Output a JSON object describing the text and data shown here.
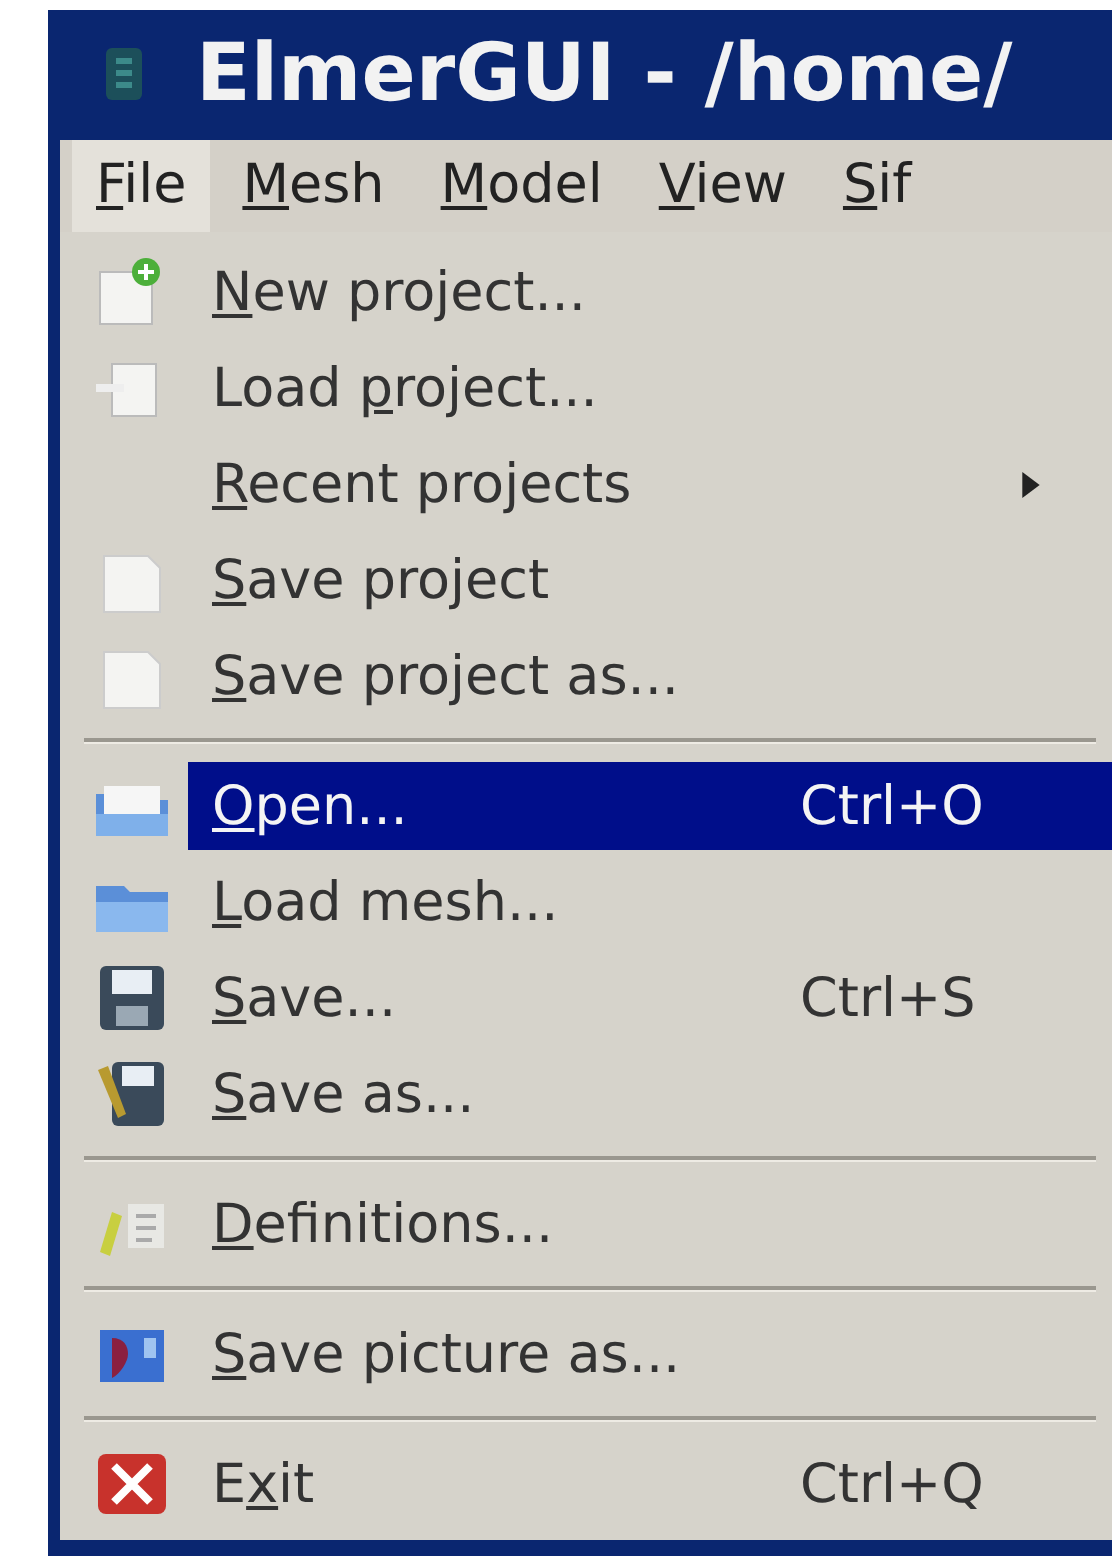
{
  "window": {
    "title": "ElmerGUI - /home/"
  },
  "menubar": [
    {
      "access_key": "F",
      "after": "ile",
      "selected": true
    },
    {
      "access_key": "M",
      "after": "esh",
      "selected": false
    },
    {
      "access_key": "M",
      "after": "odel",
      "selected": false
    },
    {
      "access_key": "V",
      "after": "iew",
      "selected": false
    },
    {
      "access_key": "S",
      "after": "if",
      "selected": false
    }
  ],
  "menu": [
    {
      "kind": "item",
      "access_key": "N",
      "after": "ew project...",
      "selected": false
    },
    {
      "kind": "item",
      "before": "Load ",
      "access_key": "p",
      "after": "roject...",
      "selected": false
    },
    {
      "kind": "item",
      "access_key": "R",
      "after": "ecent projects",
      "has_submenu": true,
      "selected": false
    },
    {
      "kind": "item",
      "access_key": "S",
      "after": "ave project",
      "selected": false
    },
    {
      "kind": "item",
      "access_key": "S",
      "after": "ave project as...",
      "selected": false
    },
    {
      "kind": "separator"
    },
    {
      "kind": "item",
      "access_key": "O",
      "after": "pen...",
      "shortcut": "Ctrl+O",
      "selected": true
    },
    {
      "kind": "item",
      "access_key": "L",
      "after": "oad mesh...",
      "selected": false
    },
    {
      "kind": "item",
      "access_key": "S",
      "after": "ave...",
      "shortcut": "Ctrl+S",
      "selected": false
    },
    {
      "kind": "item",
      "access_key": "S",
      "after": "ave as...",
      "selected": false
    },
    {
      "kind": "separator"
    },
    {
      "kind": "item",
      "access_key": "D",
      "after": "efinitions...",
      "selected": false
    },
    {
      "kind": "separator"
    },
    {
      "kind": "item",
      "access_key": "S",
      "after": "ave picture as...",
      "selected": false
    },
    {
      "kind": "separator"
    },
    {
      "kind": "item",
      "before": "E",
      "access_key": "x",
      "after": "it",
      "shortcut": "Ctrl+Q",
      "selected": false
    }
  ]
}
